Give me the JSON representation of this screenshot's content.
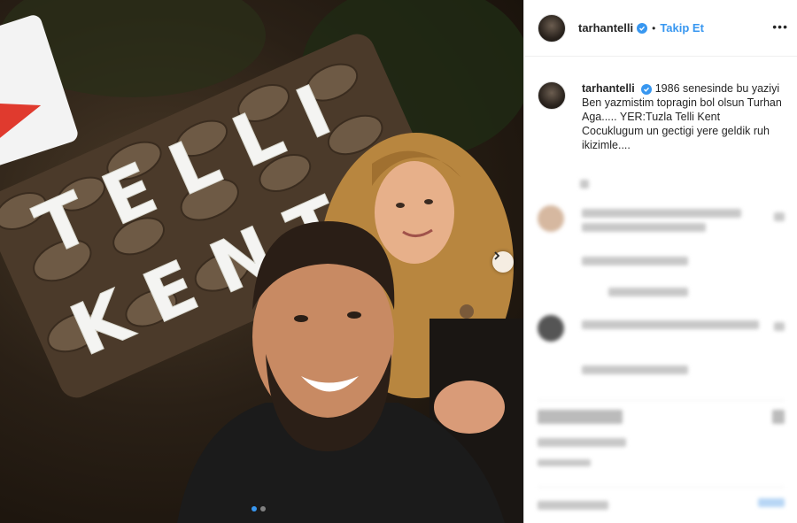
{
  "post": {
    "username": "tarhantelli",
    "bullet": "•",
    "follow_label": "Takip Et",
    "more_label": "•••",
    "caption_username": "tarhantelli",
    "caption_text": "1986 senesinde bu yaziyi Ben yazmistim topragin bol olsun Turhan Aga..... YER:Tuzla Telli Kent Cocuklugum un gectigi yere geldik ruh ikizimle....",
    "sign_letters": [
      "T",
      "E",
      "L",
      "L",
      "I",
      "K",
      "E",
      "N",
      "T"
    ]
  },
  "colors": {
    "accent": "#3897f0",
    "text": "#262626",
    "muted": "#8e8e8e"
  },
  "icons": [
    "verified-icon",
    "chevron-right-icon",
    "more-icon"
  ],
  "carousel": {
    "pages": 2,
    "current": 1
  }
}
